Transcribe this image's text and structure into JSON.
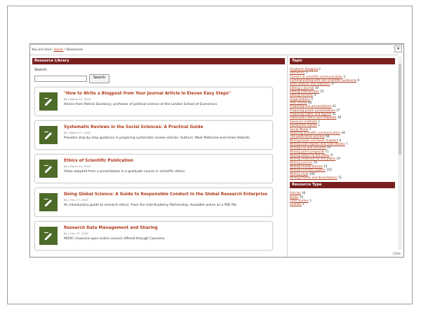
{
  "breadcrumb": {
    "prefix": "You are here:",
    "home": "Home",
    "separator": "/",
    "current": "Resources"
  },
  "resource_library": {
    "title": "Resource Library",
    "search_label": "Search:",
    "search_value": "",
    "search_button": "Search",
    "items": [
      {
        "title": "\"How to Write a Blogpost from Your Journal Article in Eleven Easy Steps\"",
        "date": "By | March 12, 2016",
        "desc": "Advice from Patrick Dunleavy, professor of political science at the London School of Economics.",
        "icon": "pencil-icon"
      },
      {
        "title": "Systematic Reviews in the Social Sciences: A Practical Guide",
        "date": "By | March 11, 2016",
        "desc": "Provides step-by-step guidance in preparing systematic review articles. Authors: Mark Petticrew and Helen Roberts.",
        "icon": "pencil-icon"
      },
      {
        "title": "Ethics of Scientific Publication",
        "date": "By | March 10, 2016",
        "desc": "Video adapted from a presentation in a graduate course in scientific ethics.",
        "icon": "pencil-icon"
      },
      {
        "title": "Doing Global Science: A Guide to Responsible Conduct in the Global Research Enterprise",
        "date": "By | Feb. 27, 2016",
        "desc": "An introductory guide to research ethics. From the InterAcademy Partnership. Available online as a PDF file.",
        "icon": "pencil-icon"
      },
      {
        "title": "Research Data Management and Sharing",
        "date": "By | Feb. 27, 2016",
        "desc": "MOOC (massive open online course) offered through Coursera.",
        "icon": "pencil-icon"
      }
    ]
  },
  "topic": {
    "title": "Topic",
    "items": [
      {
        "label": "Academic blogging",
        "count": "2"
      },
      {
        "label": "Altmetrics",
        "count": "1"
      },
      {
        "label": "Careers in scientific communication",
        "count": "3"
      },
      {
        "label": "Communicating with non-scientific audiences",
        "count": "6"
      },
      {
        "label": "Data analysis and statistics",
        "count": "17"
      },
      {
        "label": "Editing a journal",
        "count": "19"
      },
      {
        "label": "Editing manuscripts",
        "count": "25"
      },
      {
        "label": "Editing services",
        "count": "3"
      },
      {
        "label": "Organizations",
        "count": "4"
      },
      {
        "label": "Peer review",
        "count": "38"
      },
      {
        "label": "Preparing oral presentations",
        "count": "41"
      },
      {
        "label": "Preparing poster presentations",
        "count": "37"
      },
      {
        "label": "Preparing tables and figures",
        "count": "32"
      },
      {
        "label": "Publication ethics and etiquette",
        "count": "38"
      },
      {
        "label": "Research methods",
        "count": "1"
      },
      {
        "label": "Researcher stories",
        "count": "1"
      },
      {
        "label": "Social Media",
        "count": "1"
      },
      {
        "label": "Teaching scientific communication",
        "count": "44"
      },
      {
        "label": "The publication process",
        "count": "68"
      },
      {
        "label": "Writing books and book chapters",
        "count": "9"
      },
      {
        "label": "Writing case reports and case studies",
        "count": "7"
      },
      {
        "label": "Writing cvs and resumes",
        "count": "25"
      },
      {
        "label": "Writing grant proposals",
        "count": "71"
      },
      {
        "label": "Writing letters to the editor",
        "count": "9"
      },
      {
        "label": "Writing materials for the public",
        "count": "19"
      },
      {
        "label": "Writing process",
        "count": "75"
      },
      {
        "label": "Writing review articles",
        "count": "15"
      },
      {
        "label": "Writing scientific papers",
        "count": "155"
      },
      {
        "label": "Writing style",
        "count": "106"
      },
      {
        "label": "Writing theses and dissertations",
        "count": "11"
      }
    ]
  },
  "resource_type": {
    "title": "Resource Type",
    "items": [
      {
        "label": "Articles",
        "count": "36"
      },
      {
        "label": "Books",
        "count": "25"
      },
      {
        "label": "Case studies",
        "count": "3"
      },
      {
        "label": "Courses",
        "count": "1"
      }
    ]
  },
  "zoom": "110%",
  "colors": {
    "header_bar": "#7a1e1e",
    "link": "#b03a1a",
    "thumb": "#4e6b2a"
  }
}
